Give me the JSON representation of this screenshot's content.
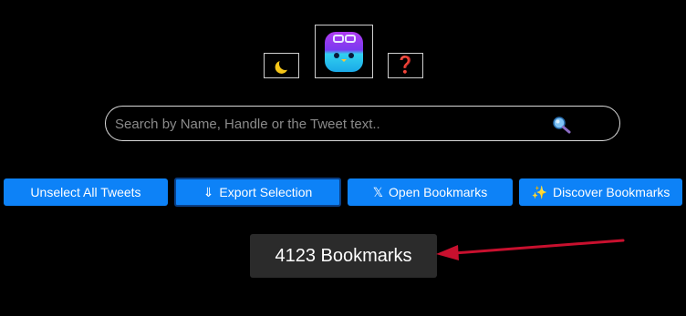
{
  "header": {
    "theme_toggle_icon": "moon-icon",
    "logo_icon": "robot-mascot-icon",
    "help_label": "❓"
  },
  "search": {
    "placeholder": "Search by Name, Handle or the Tweet text..",
    "icon": "magnifier-icon"
  },
  "actions": {
    "unselect": "Unselect All Tweets",
    "export_icon": "⇓",
    "export": "Export Selection",
    "open_icon": "𝕏",
    "open": "Open Bookmarks",
    "discover_icon": "✨",
    "discover": "Discover Bookmarks"
  },
  "bookmarks": {
    "count_text": "4123 Bookmarks"
  },
  "colors": {
    "background": "#000000",
    "button_blue": "#0d82f7",
    "arrow_red": "#c8102e",
    "badge_bg": "#2b2b2b"
  }
}
